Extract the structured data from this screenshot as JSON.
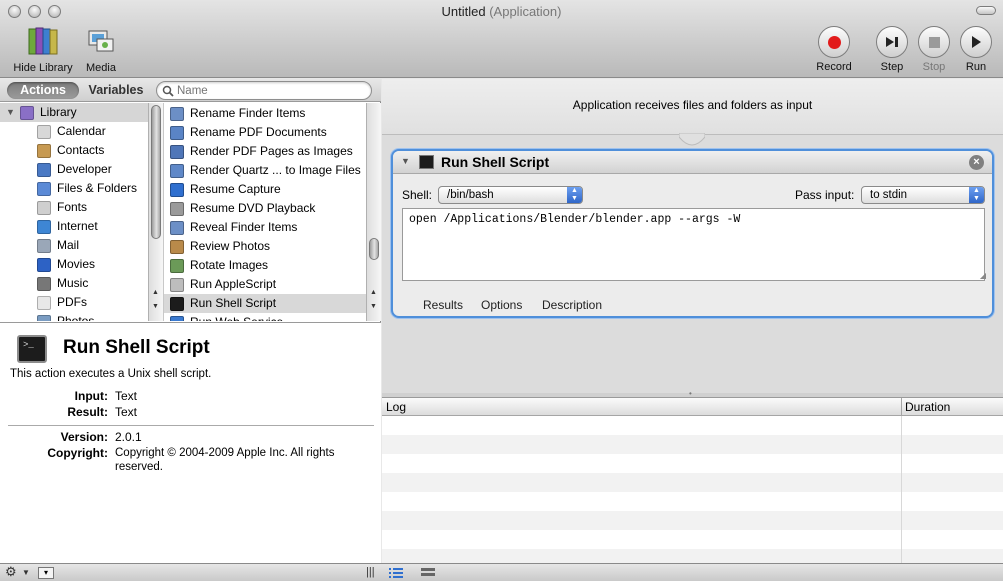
{
  "window": {
    "title": "Untitled",
    "subtitle": "(Application)"
  },
  "toolbar": {
    "hide_library": "Hide Library",
    "media": "Media",
    "record": "Record",
    "step": "Step",
    "stop": "Stop",
    "run": "Run"
  },
  "library": {
    "tab_actions": "Actions",
    "tab_variables": "Variables",
    "search_placeholder": "Name",
    "root": "Library",
    "categories": [
      {
        "label": "Calendar",
        "color": "#d8d8d8"
      },
      {
        "label": "Contacts",
        "color": "#c79a52"
      },
      {
        "label": "Developer",
        "color": "#4a79c4"
      },
      {
        "label": "Files & Folders",
        "color": "#5b8ad6"
      },
      {
        "label": "Fonts",
        "color": "#cfcfcf"
      },
      {
        "label": "Internet",
        "color": "#3e86d4"
      },
      {
        "label": "Mail",
        "color": "#9aa7b8"
      },
      {
        "label": "Movies",
        "color": "#2d62c5"
      },
      {
        "label": "Music",
        "color": "#777777"
      },
      {
        "label": "PDFs",
        "color": "#e8e8e8"
      },
      {
        "label": "Photos",
        "color": "#7a9cc2"
      }
    ],
    "actions": [
      {
        "label": "Rename Finder Items",
        "color": "#6c8fc6"
      },
      {
        "label": "Rename PDF Documents",
        "color": "#5a84c6"
      },
      {
        "label": "Render PDF Pages as Images",
        "color": "#4f76b8"
      },
      {
        "label": "Render Quartz ... to Image Files",
        "color": "#5f88c8"
      },
      {
        "label": "Resume Capture",
        "color": "#2f6fcf"
      },
      {
        "label": "Resume DVD Playback",
        "color": "#9a9a9a"
      },
      {
        "label": "Reveal Finder Items",
        "color": "#6c8fc6"
      },
      {
        "label": "Review Photos",
        "color": "#b98a4a"
      },
      {
        "label": "Rotate Images",
        "color": "#6b9a58"
      },
      {
        "label": "Run AppleScript",
        "color": "#bdbdbd"
      },
      {
        "label": "Run Shell Script",
        "color": "#1c1c1c"
      },
      {
        "label": "Run Web Service",
        "color": "#3b7ad0"
      }
    ],
    "selected_action_index": 10
  },
  "description": {
    "icon_text": ">_",
    "title": "Run Shell Script",
    "summary": "This action executes a Unix shell script.",
    "input_label": "Input:",
    "input_value": "Text",
    "result_label": "Result:",
    "result_value": "Text",
    "version_label": "Version:",
    "version_value": "2.0.1",
    "copyright_label": "Copyright:",
    "copyright_value": "Copyright © 2004-2009 Apple Inc.  All rights reserved."
  },
  "workflow": {
    "input_header": "Application receives files and folders as input",
    "action": {
      "title": "Run Shell Script",
      "shell_label": "Shell:",
      "shell_value": "/bin/bash",
      "pass_input_label": "Pass input:",
      "pass_input_value": "to stdin",
      "script": "open /Applications/Blender/blender.app --args -W",
      "tabs": [
        "Results",
        "Options",
        "Description"
      ]
    }
  },
  "log": {
    "col_log": "Log",
    "col_duration": "Duration"
  },
  "bottom": {
    "gear": "⚙",
    "menu": "▾",
    "resize": "|||"
  }
}
